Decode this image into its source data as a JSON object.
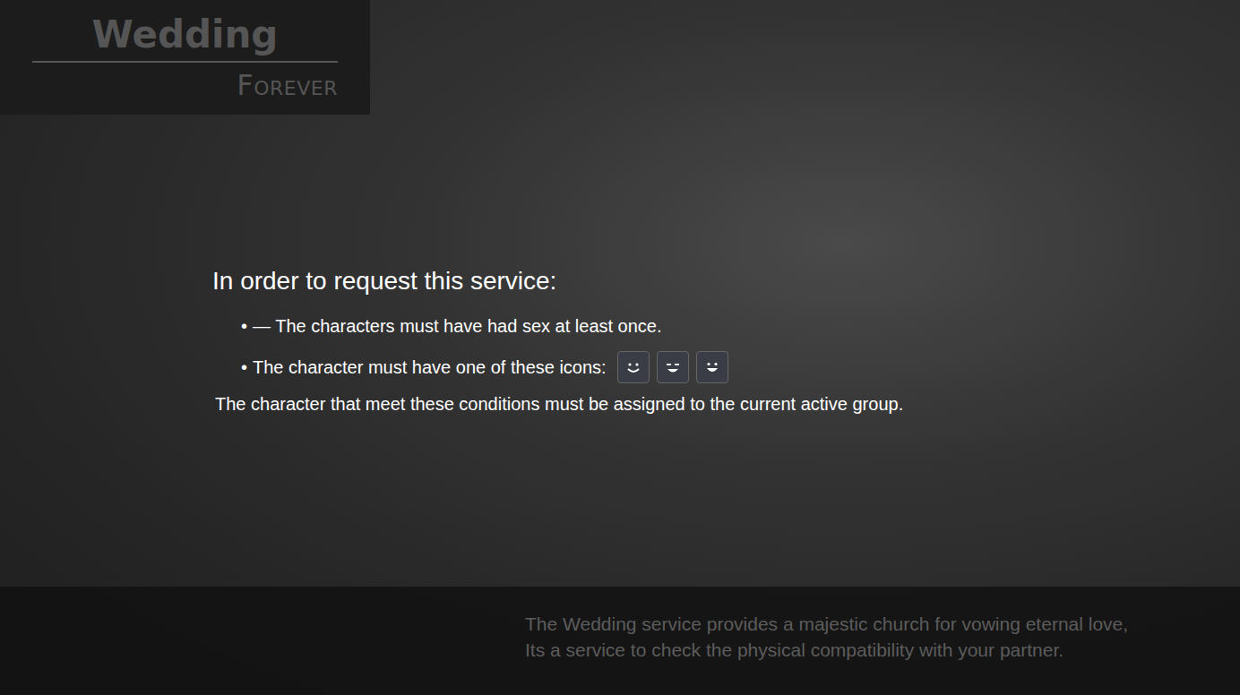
{
  "header": {
    "title": "Wedding",
    "subtitle": "FOREVER"
  },
  "requirements": {
    "heading": "In order to request this service:",
    "items": [
      {
        "kind": "text",
        "bullet": "•",
        "text": "— The characters must have had sex at least once."
      },
      {
        "kind": "icons",
        "bullet": "•",
        "text": "The character must have one of these icons:"
      }
    ],
    "note": "The character that meet these conditions must be assigned to the current active group."
  },
  "description": [
    "The Wedding service provides a majestic church for vowing eternal love,",
    "Its a service to check the physical compatibility with your partner."
  ]
}
